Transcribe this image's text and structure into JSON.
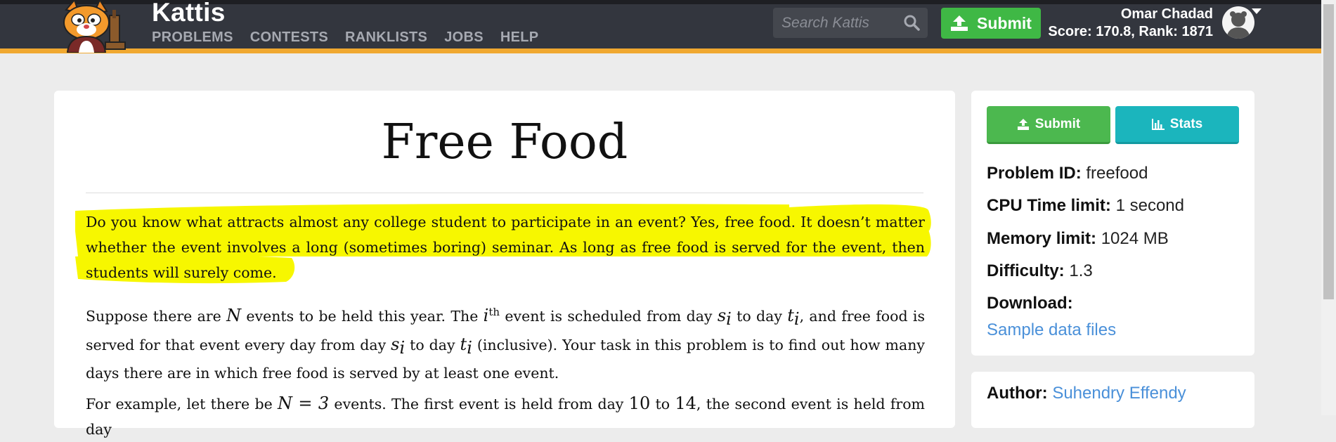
{
  "header": {
    "brand": "Kattis",
    "nav": [
      "PROBLEMS",
      "CONTESTS",
      "RANKLISTS",
      "JOBS",
      "HELP"
    ],
    "search_placeholder": "Search Kattis",
    "submit_label": "Submit",
    "user_name": "Omar Chadad",
    "user_score": "Score: 170.8, Rank: 1871"
  },
  "problem": {
    "title": "Free Food",
    "para1": "Do you know what attracts almost any college student to participate in an event? Yes, free food. It doesn’t matter whether the event involves a long (sometimes boring) seminar. As long as free food is served for the event, then students will surely come.",
    "para2": {
      "t1": "Suppose there are ",
      "N": "N",
      "t2": " events to be held this year. The ",
      "i": "i",
      "th": "th",
      "t3": " event is scheduled from day ",
      "s": "s",
      "sub_i": "i",
      "t4": " to day ",
      "t": "t",
      "t5": ", and free food is served for that event every day from day ",
      "t6": " to day ",
      "t7": " (inclusive). Your task in this problem is to find out how many days there are in which free food is served by at least one event."
    },
    "para3": {
      "t1": "For example, let there be ",
      "eq": "N = 3",
      "t2": " events. The first event is held from day ",
      "n10": "10",
      "t3": " to ",
      "n14": "14",
      "t4": ", the second event is held from day"
    },
    "highlight_color": "#f7f700"
  },
  "sidebar": {
    "submit_label": "Submit",
    "stats_label": "Stats",
    "problem_id_label": "Problem ID:",
    "problem_id": "freefood",
    "cpu_label": "CPU Time limit:",
    "cpu": "1 second",
    "memory_label": "Memory limit:",
    "memory": "1024 MB",
    "difficulty_label": "Difficulty:",
    "difficulty": "1.3",
    "download_label": "Download:",
    "download_link": "Sample data files",
    "author_label": "Author:",
    "author": "Suhendry Effendy"
  },
  "colors": {
    "navbar": "#33363e",
    "accent": "#f0a830",
    "green": "#3fb845",
    "teal": "#1bb5bd",
    "link": "#4a90d9"
  }
}
